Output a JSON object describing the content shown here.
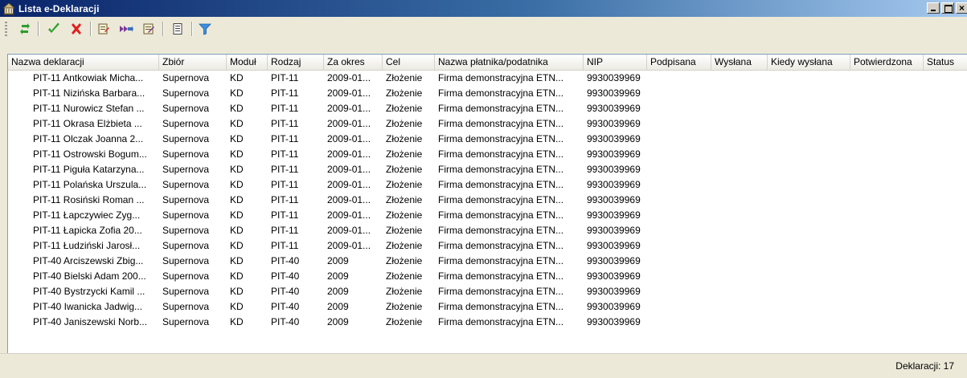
{
  "window": {
    "title": "Lista e-Deklaracji"
  },
  "toolbar": {
    "buttons": [
      {
        "name": "refresh-icon"
      },
      {
        "name": "checkmark-icon"
      },
      {
        "name": "delete-icon"
      },
      {
        "name": "sign-document-icon"
      },
      {
        "name": "send-icon"
      },
      {
        "name": "confirm-document-icon"
      },
      {
        "name": "preview-document-icon"
      },
      {
        "name": "filter-icon"
      }
    ]
  },
  "table": {
    "columns": [
      "Nazwa deklaracji",
      "Zbiór",
      "Moduł",
      "Rodzaj",
      "Za okres",
      "Cel",
      "Nazwa płatnika/podatnika",
      "NIP",
      "Podpisana",
      "Wysłana",
      "Kiedy wysłana",
      "Potwierdzona",
      "Status"
    ],
    "rows": [
      [
        "PIT-11 Antkowiak Micha...",
        "Supernova",
        "KD",
        "PIT-11",
        "2009-01...",
        "Złożenie",
        "Firma demonstracyjna ETN...",
        "9930039969",
        "",
        "",
        "",
        "",
        ""
      ],
      [
        "PIT-11 Nizińska Barbara...",
        "Supernova",
        "KD",
        "PIT-11",
        "2009-01...",
        "Złożenie",
        "Firma demonstracyjna ETN...",
        "9930039969",
        "",
        "",
        "",
        "",
        ""
      ],
      [
        "PIT-11 Nurowicz Stefan ...",
        "Supernova",
        "KD",
        "PIT-11",
        "2009-01...",
        "Złożenie",
        "Firma demonstracyjna ETN...",
        "9930039969",
        "",
        "",
        "",
        "",
        ""
      ],
      [
        "PIT-11 Okrasa Elżbieta ...",
        "Supernova",
        "KD",
        "PIT-11",
        "2009-01...",
        "Złożenie",
        "Firma demonstracyjna ETN...",
        "9930039969",
        "",
        "",
        "",
        "",
        ""
      ],
      [
        "PIT-11 Olczak Joanna 2...",
        "Supernova",
        "KD",
        "PIT-11",
        "2009-01...",
        "Złożenie",
        "Firma demonstracyjna ETN...",
        "9930039969",
        "",
        "",
        "",
        "",
        ""
      ],
      [
        "PIT-11 Ostrowski Bogum...",
        "Supernova",
        "KD",
        "PIT-11",
        "2009-01...",
        "Złożenie",
        "Firma demonstracyjna ETN...",
        "9930039969",
        "",
        "",
        "",
        "",
        ""
      ],
      [
        "PIT-11 Piguła Katarzyna...",
        "Supernova",
        "KD",
        "PIT-11",
        "2009-01...",
        "Złożenie",
        "Firma demonstracyjna ETN...",
        "9930039969",
        "",
        "",
        "",
        "",
        ""
      ],
      [
        "PIT-11 Polańska Urszula...",
        "Supernova",
        "KD",
        "PIT-11",
        "2009-01...",
        "Złożenie",
        "Firma demonstracyjna ETN...",
        "9930039969",
        "",
        "",
        "",
        "",
        ""
      ],
      [
        "PIT-11 Rosiński Roman ...",
        "Supernova",
        "KD",
        "PIT-11",
        "2009-01...",
        "Złożenie",
        "Firma demonstracyjna ETN...",
        "9930039969",
        "",
        "",
        "",
        "",
        ""
      ],
      [
        "PIT-11 Łapczywiec Zyg...",
        "Supernova",
        "KD",
        "PIT-11",
        "2009-01...",
        "Złożenie",
        "Firma demonstracyjna ETN...",
        "9930039969",
        "",
        "",
        "",
        "",
        ""
      ],
      [
        "PIT-11 Łapicka Zofia 20...",
        "Supernova",
        "KD",
        "PIT-11",
        "2009-01...",
        "Złożenie",
        "Firma demonstracyjna ETN...",
        "9930039969",
        "",
        "",
        "",
        "",
        ""
      ],
      [
        "PIT-11 Łudziński Jarosł...",
        "Supernova",
        "KD",
        "PIT-11",
        "2009-01...",
        "Złożenie",
        "Firma demonstracyjna ETN...",
        "9930039969",
        "",
        "",
        "",
        "",
        ""
      ],
      [
        "PIT-40 Arciszewski Zbig...",
        "Supernova",
        "KD",
        "PIT-40",
        "2009",
        "Złożenie",
        "Firma demonstracyjna ETN...",
        "9930039969",
        "",
        "",
        "",
        "",
        ""
      ],
      [
        "PIT-40 Bielski Adam 200...",
        "Supernova",
        "KD",
        "PIT-40",
        "2009",
        "Złożenie",
        "Firma demonstracyjna ETN...",
        "9930039969",
        "",
        "",
        "",
        "",
        ""
      ],
      [
        "PIT-40 Bystrzycki Kamil ...",
        "Supernova",
        "KD",
        "PIT-40",
        "2009",
        "Złożenie",
        "Firma demonstracyjna ETN...",
        "9930039969",
        "",
        "",
        "",
        "",
        ""
      ],
      [
        "PIT-40 Iwanicka Jadwig...",
        "Supernova",
        "KD",
        "PIT-40",
        "2009",
        "Złożenie",
        "Firma demonstracyjna ETN...",
        "9930039969",
        "",
        "",
        "",
        "",
        ""
      ],
      [
        "PIT-40 Janiszewski Norb...",
        "Supernova",
        "KD",
        "PIT-40",
        "2009",
        "Złożenie",
        "Firma demonstracyjna ETN...",
        "9930039969",
        "",
        "",
        "",
        "",
        ""
      ]
    ]
  },
  "status": {
    "count_text": "Deklaracji: 17"
  }
}
